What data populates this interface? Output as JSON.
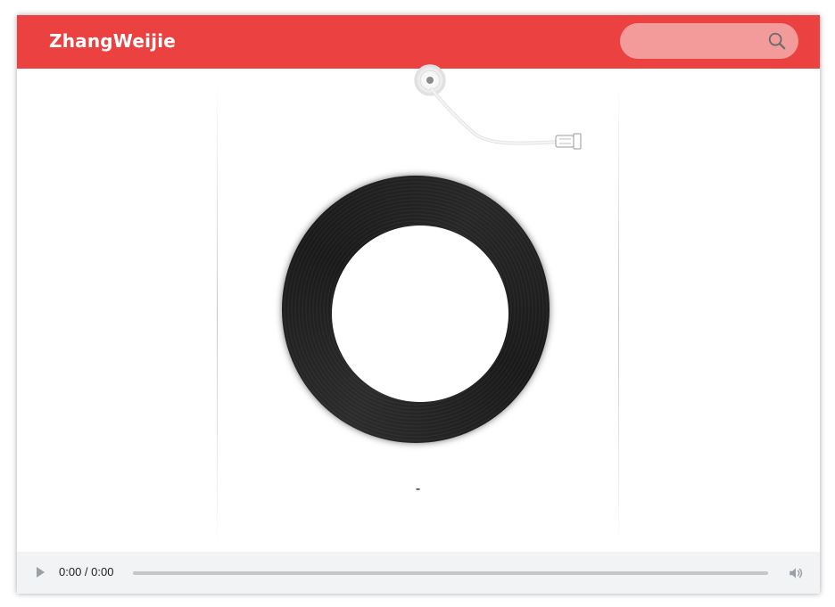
{
  "header": {
    "brand": "ZhangWeijie",
    "background_color": "#ec4141",
    "search": {
      "value": "",
      "placeholder": "",
      "icon": "search-icon"
    }
  },
  "stage": {
    "disc_icon": "vinyl-record",
    "needle_icon": "tonearm-needle",
    "song_title": "-"
  },
  "audio_player": {
    "play_icon": "play-icon",
    "time_display": "0:00 / 0:00",
    "progress": 0,
    "volume_icon": "volume-icon",
    "background_color": "#f1f3f4"
  }
}
